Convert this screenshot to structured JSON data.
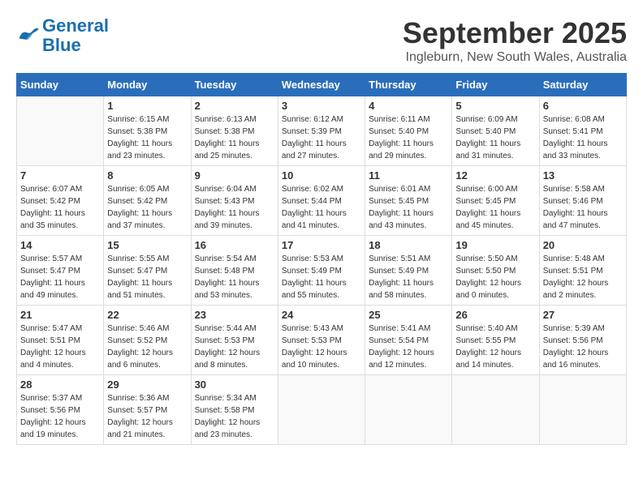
{
  "header": {
    "logo_line1": "General",
    "logo_line2": "Blue",
    "month": "September 2025",
    "location": "Ingleburn, New South Wales, Australia"
  },
  "weekdays": [
    "Sunday",
    "Monday",
    "Tuesday",
    "Wednesday",
    "Thursday",
    "Friday",
    "Saturday"
  ],
  "weeks": [
    [
      {
        "day": "",
        "sunrise": "",
        "sunset": "",
        "daylight": ""
      },
      {
        "day": "1",
        "sunrise": "6:15 AM",
        "sunset": "5:38 PM",
        "daylight": "11 hours and 23 minutes."
      },
      {
        "day": "2",
        "sunrise": "6:13 AM",
        "sunset": "5:38 PM",
        "daylight": "11 hours and 25 minutes."
      },
      {
        "day": "3",
        "sunrise": "6:12 AM",
        "sunset": "5:39 PM",
        "daylight": "11 hours and 27 minutes."
      },
      {
        "day": "4",
        "sunrise": "6:11 AM",
        "sunset": "5:40 PM",
        "daylight": "11 hours and 29 minutes."
      },
      {
        "day": "5",
        "sunrise": "6:09 AM",
        "sunset": "5:40 PM",
        "daylight": "11 hours and 31 minutes."
      },
      {
        "day": "6",
        "sunrise": "6:08 AM",
        "sunset": "5:41 PM",
        "daylight": "11 hours and 33 minutes."
      }
    ],
    [
      {
        "day": "7",
        "sunrise": "6:07 AM",
        "sunset": "5:42 PM",
        "daylight": "11 hours and 35 minutes."
      },
      {
        "day": "8",
        "sunrise": "6:05 AM",
        "sunset": "5:42 PM",
        "daylight": "11 hours and 37 minutes."
      },
      {
        "day": "9",
        "sunrise": "6:04 AM",
        "sunset": "5:43 PM",
        "daylight": "11 hours and 39 minutes."
      },
      {
        "day": "10",
        "sunrise": "6:02 AM",
        "sunset": "5:44 PM",
        "daylight": "11 hours and 41 minutes."
      },
      {
        "day": "11",
        "sunrise": "6:01 AM",
        "sunset": "5:45 PM",
        "daylight": "11 hours and 43 minutes."
      },
      {
        "day": "12",
        "sunrise": "6:00 AM",
        "sunset": "5:45 PM",
        "daylight": "11 hours and 45 minutes."
      },
      {
        "day": "13",
        "sunrise": "5:58 AM",
        "sunset": "5:46 PM",
        "daylight": "11 hours and 47 minutes."
      }
    ],
    [
      {
        "day": "14",
        "sunrise": "5:57 AM",
        "sunset": "5:47 PM",
        "daylight": "11 hours and 49 minutes."
      },
      {
        "day": "15",
        "sunrise": "5:55 AM",
        "sunset": "5:47 PM",
        "daylight": "11 hours and 51 minutes."
      },
      {
        "day": "16",
        "sunrise": "5:54 AM",
        "sunset": "5:48 PM",
        "daylight": "11 hours and 53 minutes."
      },
      {
        "day": "17",
        "sunrise": "5:53 AM",
        "sunset": "5:49 PM",
        "daylight": "11 hours and 55 minutes."
      },
      {
        "day": "18",
        "sunrise": "5:51 AM",
        "sunset": "5:49 PM",
        "daylight": "11 hours and 58 minutes."
      },
      {
        "day": "19",
        "sunrise": "5:50 AM",
        "sunset": "5:50 PM",
        "daylight": "12 hours and 0 minutes."
      },
      {
        "day": "20",
        "sunrise": "5:48 AM",
        "sunset": "5:51 PM",
        "daylight": "12 hours and 2 minutes."
      }
    ],
    [
      {
        "day": "21",
        "sunrise": "5:47 AM",
        "sunset": "5:51 PM",
        "daylight": "12 hours and 4 minutes."
      },
      {
        "day": "22",
        "sunrise": "5:46 AM",
        "sunset": "5:52 PM",
        "daylight": "12 hours and 6 minutes."
      },
      {
        "day": "23",
        "sunrise": "5:44 AM",
        "sunset": "5:53 PM",
        "daylight": "12 hours and 8 minutes."
      },
      {
        "day": "24",
        "sunrise": "5:43 AM",
        "sunset": "5:53 PM",
        "daylight": "12 hours and 10 minutes."
      },
      {
        "day": "25",
        "sunrise": "5:41 AM",
        "sunset": "5:54 PM",
        "daylight": "12 hours and 12 minutes."
      },
      {
        "day": "26",
        "sunrise": "5:40 AM",
        "sunset": "5:55 PM",
        "daylight": "12 hours and 14 minutes."
      },
      {
        "day": "27",
        "sunrise": "5:39 AM",
        "sunset": "5:56 PM",
        "daylight": "12 hours and 16 minutes."
      }
    ],
    [
      {
        "day": "28",
        "sunrise": "5:37 AM",
        "sunset": "5:56 PM",
        "daylight": "12 hours and 19 minutes."
      },
      {
        "day": "29",
        "sunrise": "5:36 AM",
        "sunset": "5:57 PM",
        "daylight": "12 hours and 21 minutes."
      },
      {
        "day": "30",
        "sunrise": "5:34 AM",
        "sunset": "5:58 PM",
        "daylight": "12 hours and 23 minutes."
      },
      {
        "day": "",
        "sunrise": "",
        "sunset": "",
        "daylight": ""
      },
      {
        "day": "",
        "sunrise": "",
        "sunset": "",
        "daylight": ""
      },
      {
        "day": "",
        "sunrise": "",
        "sunset": "",
        "daylight": ""
      },
      {
        "day": "",
        "sunrise": "",
        "sunset": "",
        "daylight": ""
      }
    ]
  ]
}
